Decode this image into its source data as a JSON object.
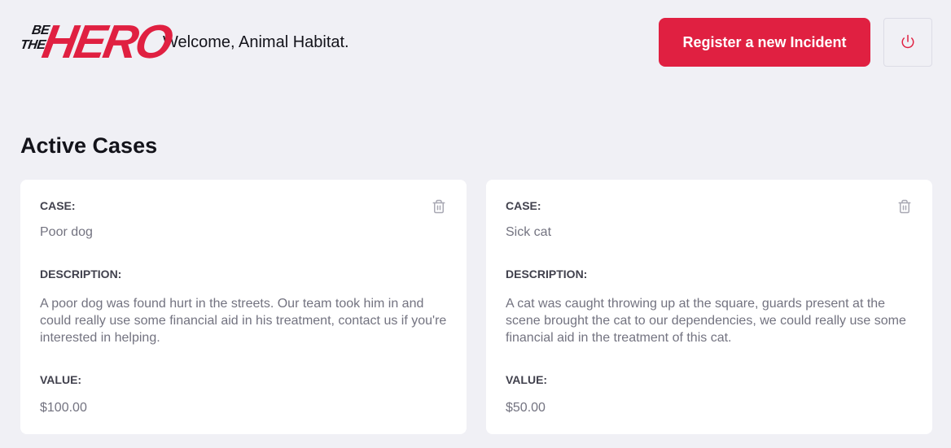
{
  "header": {
    "logo_be": "BE",
    "logo_the": "THE",
    "logo_hero": "HERO",
    "welcome": "Welcome, Animal Habitat.",
    "register_label": "Register a new Incident"
  },
  "main": {
    "title": "Active Cases",
    "cards": [
      {
        "case_label": "CASE:",
        "case": "Poor dog",
        "description_label": "DESCRIPTION:",
        "description": "A poor dog was found hurt in the streets. Our team took him in and could really use some financial aid in his treatment, contact us if you're interested in helping.",
        "value_label": "VALUE:",
        "value": "$100.00"
      },
      {
        "case_label": "CASE:",
        "case": "Sick cat",
        "description_label": "DESCRIPTION:",
        "description": "A cat was caught throwing up at the square, guards present at the scene brought the cat to our dependencies, we could really use some financial aid in the treatment of this cat.",
        "value_label": "VALUE:",
        "value": "$50.00"
      }
    ]
  },
  "colors": {
    "brand": "#e02041",
    "background": "#f0f0f5",
    "card": "#ffffff",
    "label": "#41414d",
    "text": "#737380"
  },
  "icons": {
    "logout": "power-icon",
    "delete": "trash-icon"
  }
}
